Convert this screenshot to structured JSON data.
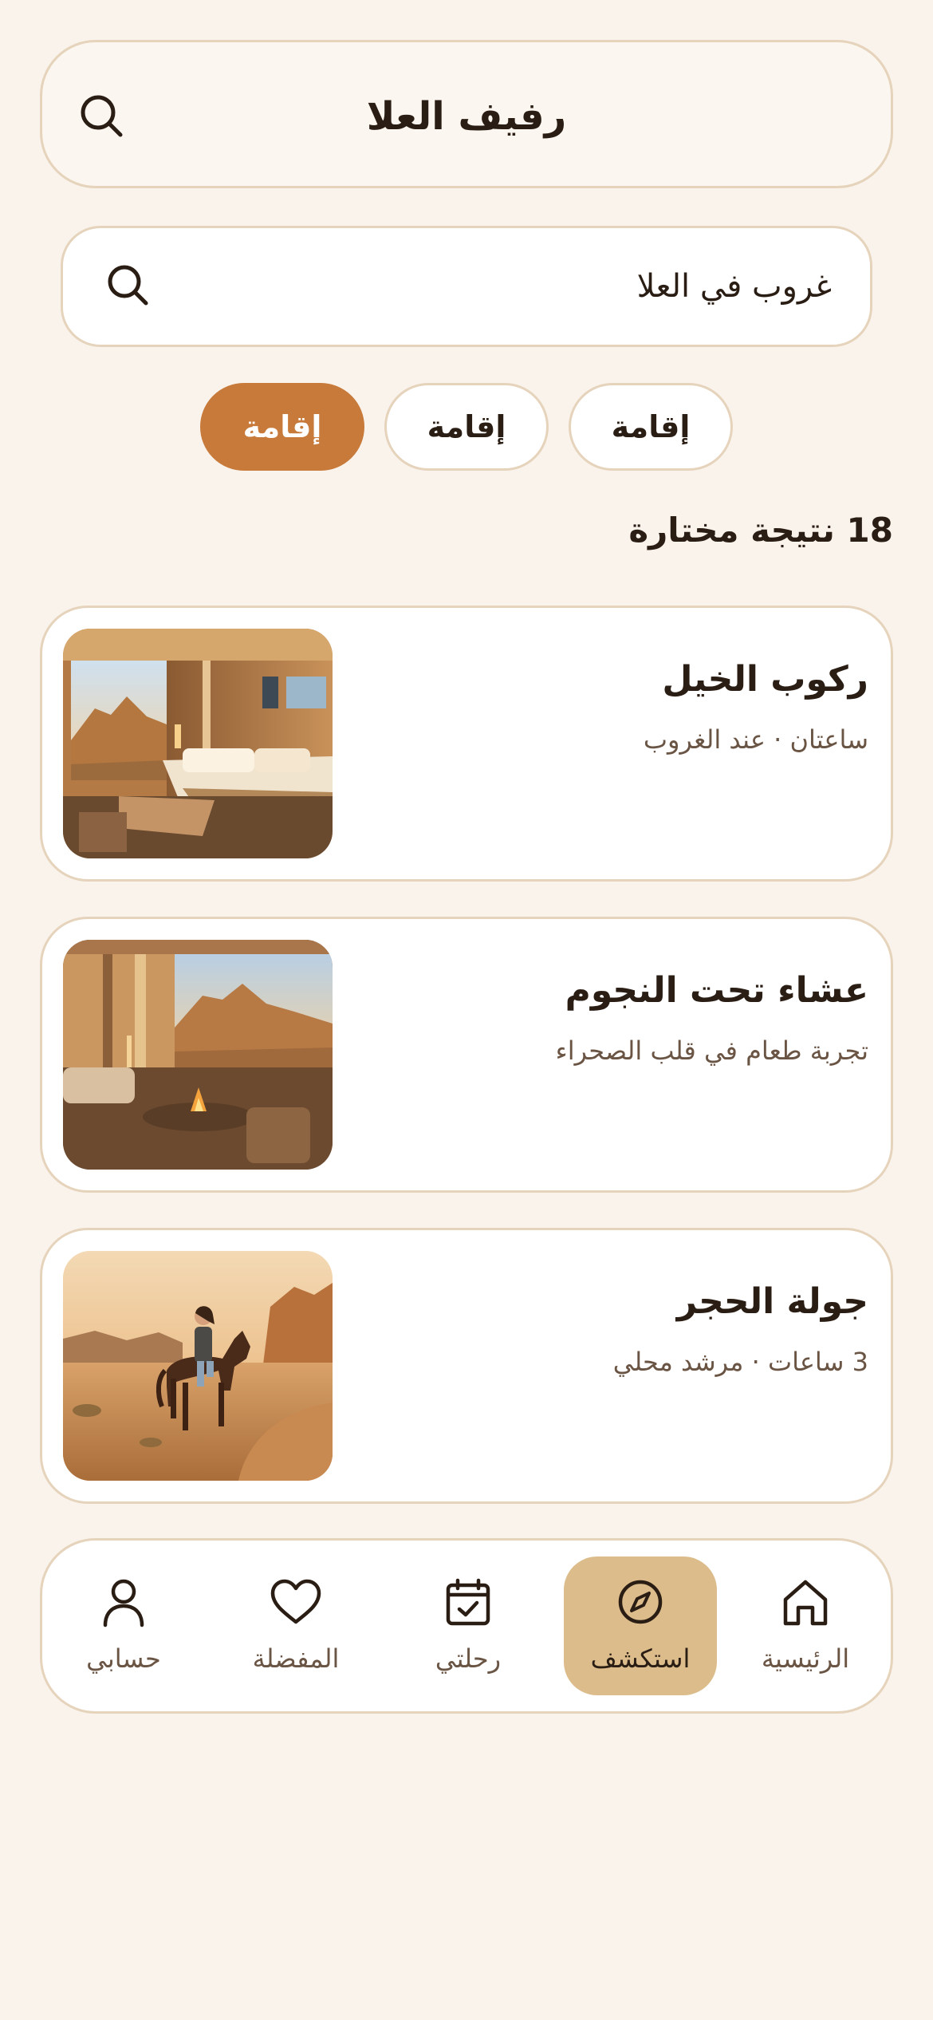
{
  "header": {
    "title": "رفيف العلا",
    "search_icon": "search-icon"
  },
  "search": {
    "value": "غروب في العلا",
    "icon": "search-icon"
  },
  "chips": [
    {
      "label": "إقامة",
      "active": false
    },
    {
      "label": "إقامة",
      "active": false
    },
    {
      "label": "إقامة",
      "active": true
    }
  ],
  "results": {
    "count_text": "18 نتيجة مختارة"
  },
  "cards": [
    {
      "title": "ركوب الخيل",
      "subtitle": "ساعتان · عند الغروب",
      "image": "desert-bedroom-photo"
    },
    {
      "title": "عشاء تحت النجوم",
      "subtitle": "تجربة طعام في قلب الصحراء",
      "image": "desert-lounge-fire-photo"
    },
    {
      "title": "جولة الحجر",
      "subtitle": "3 ساعات · مرشد محلي",
      "image": "desert-horse-rider-photo"
    }
  ],
  "nav": [
    {
      "label": "الرئيسية",
      "icon": "home-icon",
      "active": false
    },
    {
      "label": "استكشف",
      "icon": "compass-icon",
      "active": true
    },
    {
      "label": "رحلتي",
      "icon": "calendar-check-icon",
      "active": false
    },
    {
      "label": "المفضلة",
      "icon": "heart-icon",
      "active": false
    },
    {
      "label": "حسابي",
      "icon": "user-icon",
      "active": false
    }
  ],
  "colors": {
    "background": "#f9f3ec",
    "accent": "#c77a3a",
    "border": "#e6d3bb",
    "nav_active": "#dcbc8b",
    "text": "#2a1d14",
    "muted_text": "#6a5444"
  }
}
